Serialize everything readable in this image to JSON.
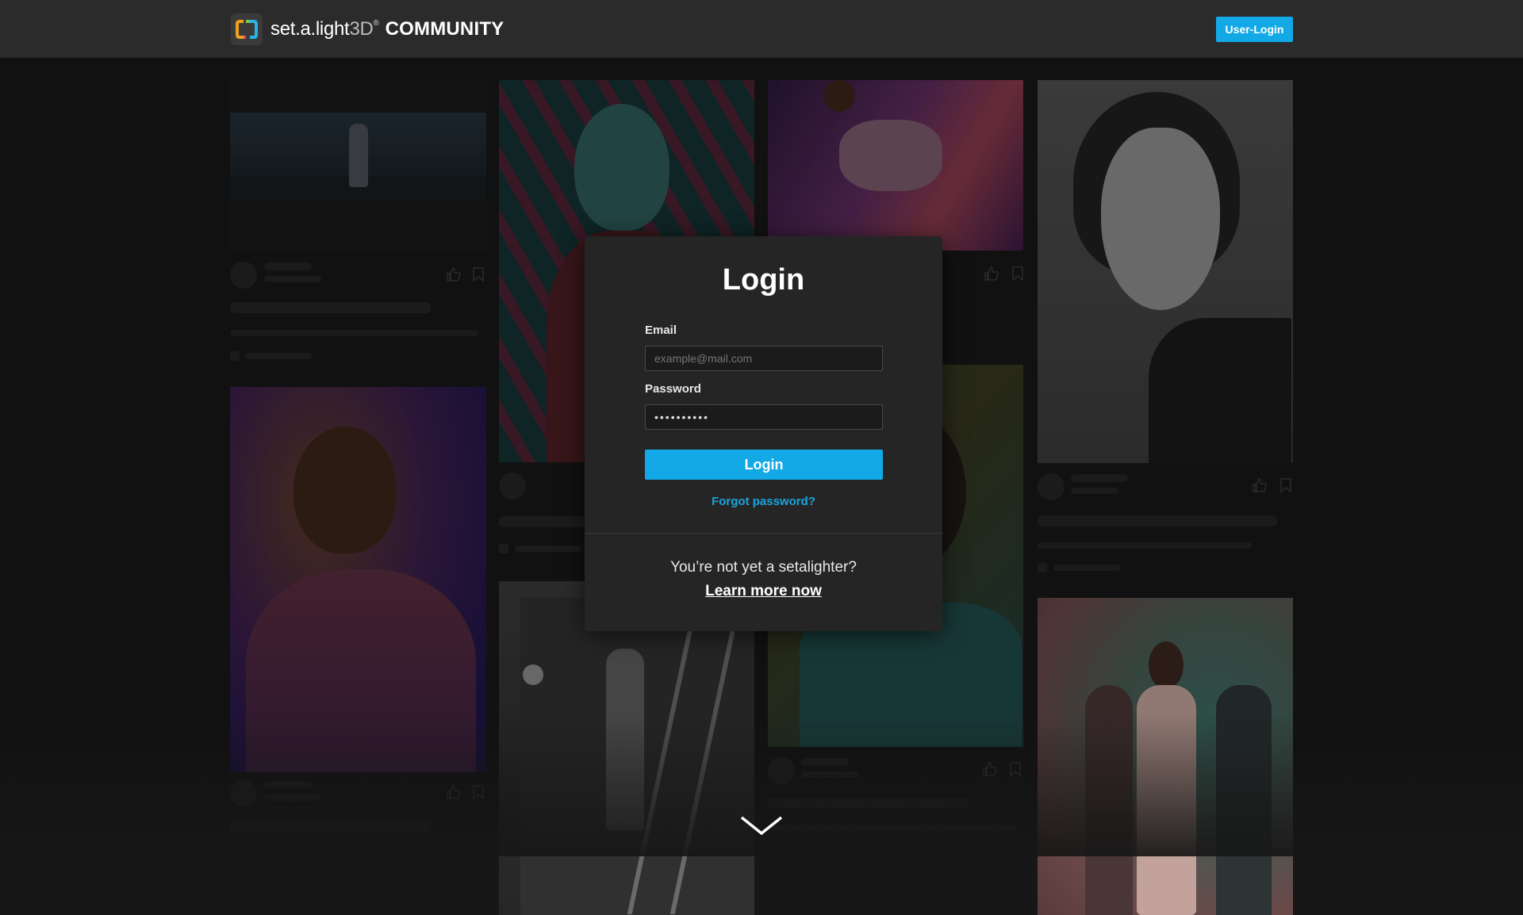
{
  "header": {
    "brand_name": "set.a.light",
    "brand_3d": "3D",
    "brand_registered": "®",
    "brand_suffix": "COMMUNITY",
    "user_login_label": "User-Login"
  },
  "login": {
    "title": "Login",
    "email_label": "Email",
    "email_placeholder": "example@mail.com",
    "password_label": "Password",
    "password_value": "••••••••••",
    "submit_label": "Login",
    "forgot_label": "Forgot password?",
    "note": "You’re not yet a setalighter?",
    "learn_more_label": "Learn more now"
  },
  "colors": {
    "accent": "#12a9e6",
    "background": "#171717",
    "header": "#2b2b2b",
    "modal": "#252525"
  },
  "icons": [
    "thumbs-up-icon",
    "bookmark-icon",
    "chevron-down-icon"
  ]
}
